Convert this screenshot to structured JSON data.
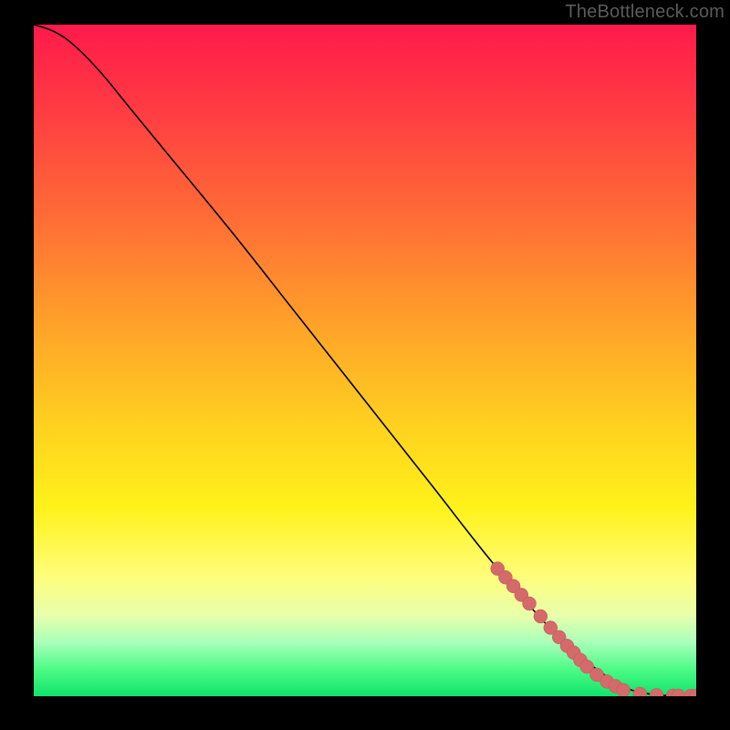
{
  "attribution": "TheBottleneck.com",
  "colors": {
    "frame": "#000000",
    "curve": "#000000",
    "marker": "#d46a6a",
    "gradient_stops": [
      "#ff1a4b",
      "#ff3a43",
      "#ff6a36",
      "#ffa329",
      "#ffd21f",
      "#fff21a",
      "#fffd7a",
      "#e8ffab",
      "#a8ffba",
      "#4cfb86",
      "#11e36a"
    ]
  },
  "chart_data": {
    "type": "line",
    "title": "",
    "xlabel": "",
    "ylabel": "",
    "xlim": [
      0,
      100
    ],
    "ylim": [
      0,
      100
    ],
    "curve": {
      "name": "bottleneck-curve",
      "x": [
        0,
        3,
        6,
        10,
        15,
        20,
        30,
        40,
        50,
        60,
        70,
        80,
        85,
        88,
        90,
        92,
        94,
        96,
        98,
        100
      ],
      "y": [
        100,
        99,
        97,
        93,
        87,
        81,
        69,
        56.5,
        44,
        31.5,
        19,
        8,
        4,
        2,
        1,
        0.5,
        0.2,
        0.1,
        0.05,
        0.05
      ]
    },
    "markers": {
      "name": "highlight-points",
      "points": [
        {
          "x": 70.0,
          "y": 19.0
        },
        {
          "x": 71.2,
          "y": 17.7
        },
        {
          "x": 72.4,
          "y": 16.4
        },
        {
          "x": 73.6,
          "y": 15.1
        },
        {
          "x": 74.8,
          "y": 13.8
        },
        {
          "x": 76.5,
          "y": 11.9
        },
        {
          "x": 78.0,
          "y": 10.2
        },
        {
          "x": 79.3,
          "y": 8.8
        },
        {
          "x": 80.5,
          "y": 7.5
        },
        {
          "x": 81.5,
          "y": 6.5
        },
        {
          "x": 82.5,
          "y": 5.4
        },
        {
          "x": 83.5,
          "y": 4.4
        },
        {
          "x": 85.0,
          "y": 3.2
        },
        {
          "x": 86.5,
          "y": 2.2
        },
        {
          "x": 87.8,
          "y": 1.5
        },
        {
          "x": 89.0,
          "y": 0.9
        },
        {
          "x": 91.5,
          "y": 0.35
        },
        {
          "x": 94.0,
          "y": 0.15
        },
        {
          "x": 96.5,
          "y": 0.08
        },
        {
          "x": 97.3,
          "y": 0.07
        },
        {
          "x": 99.2,
          "y": 0.05
        },
        {
          "x": 100.0,
          "y": 0.05
        }
      ]
    }
  }
}
